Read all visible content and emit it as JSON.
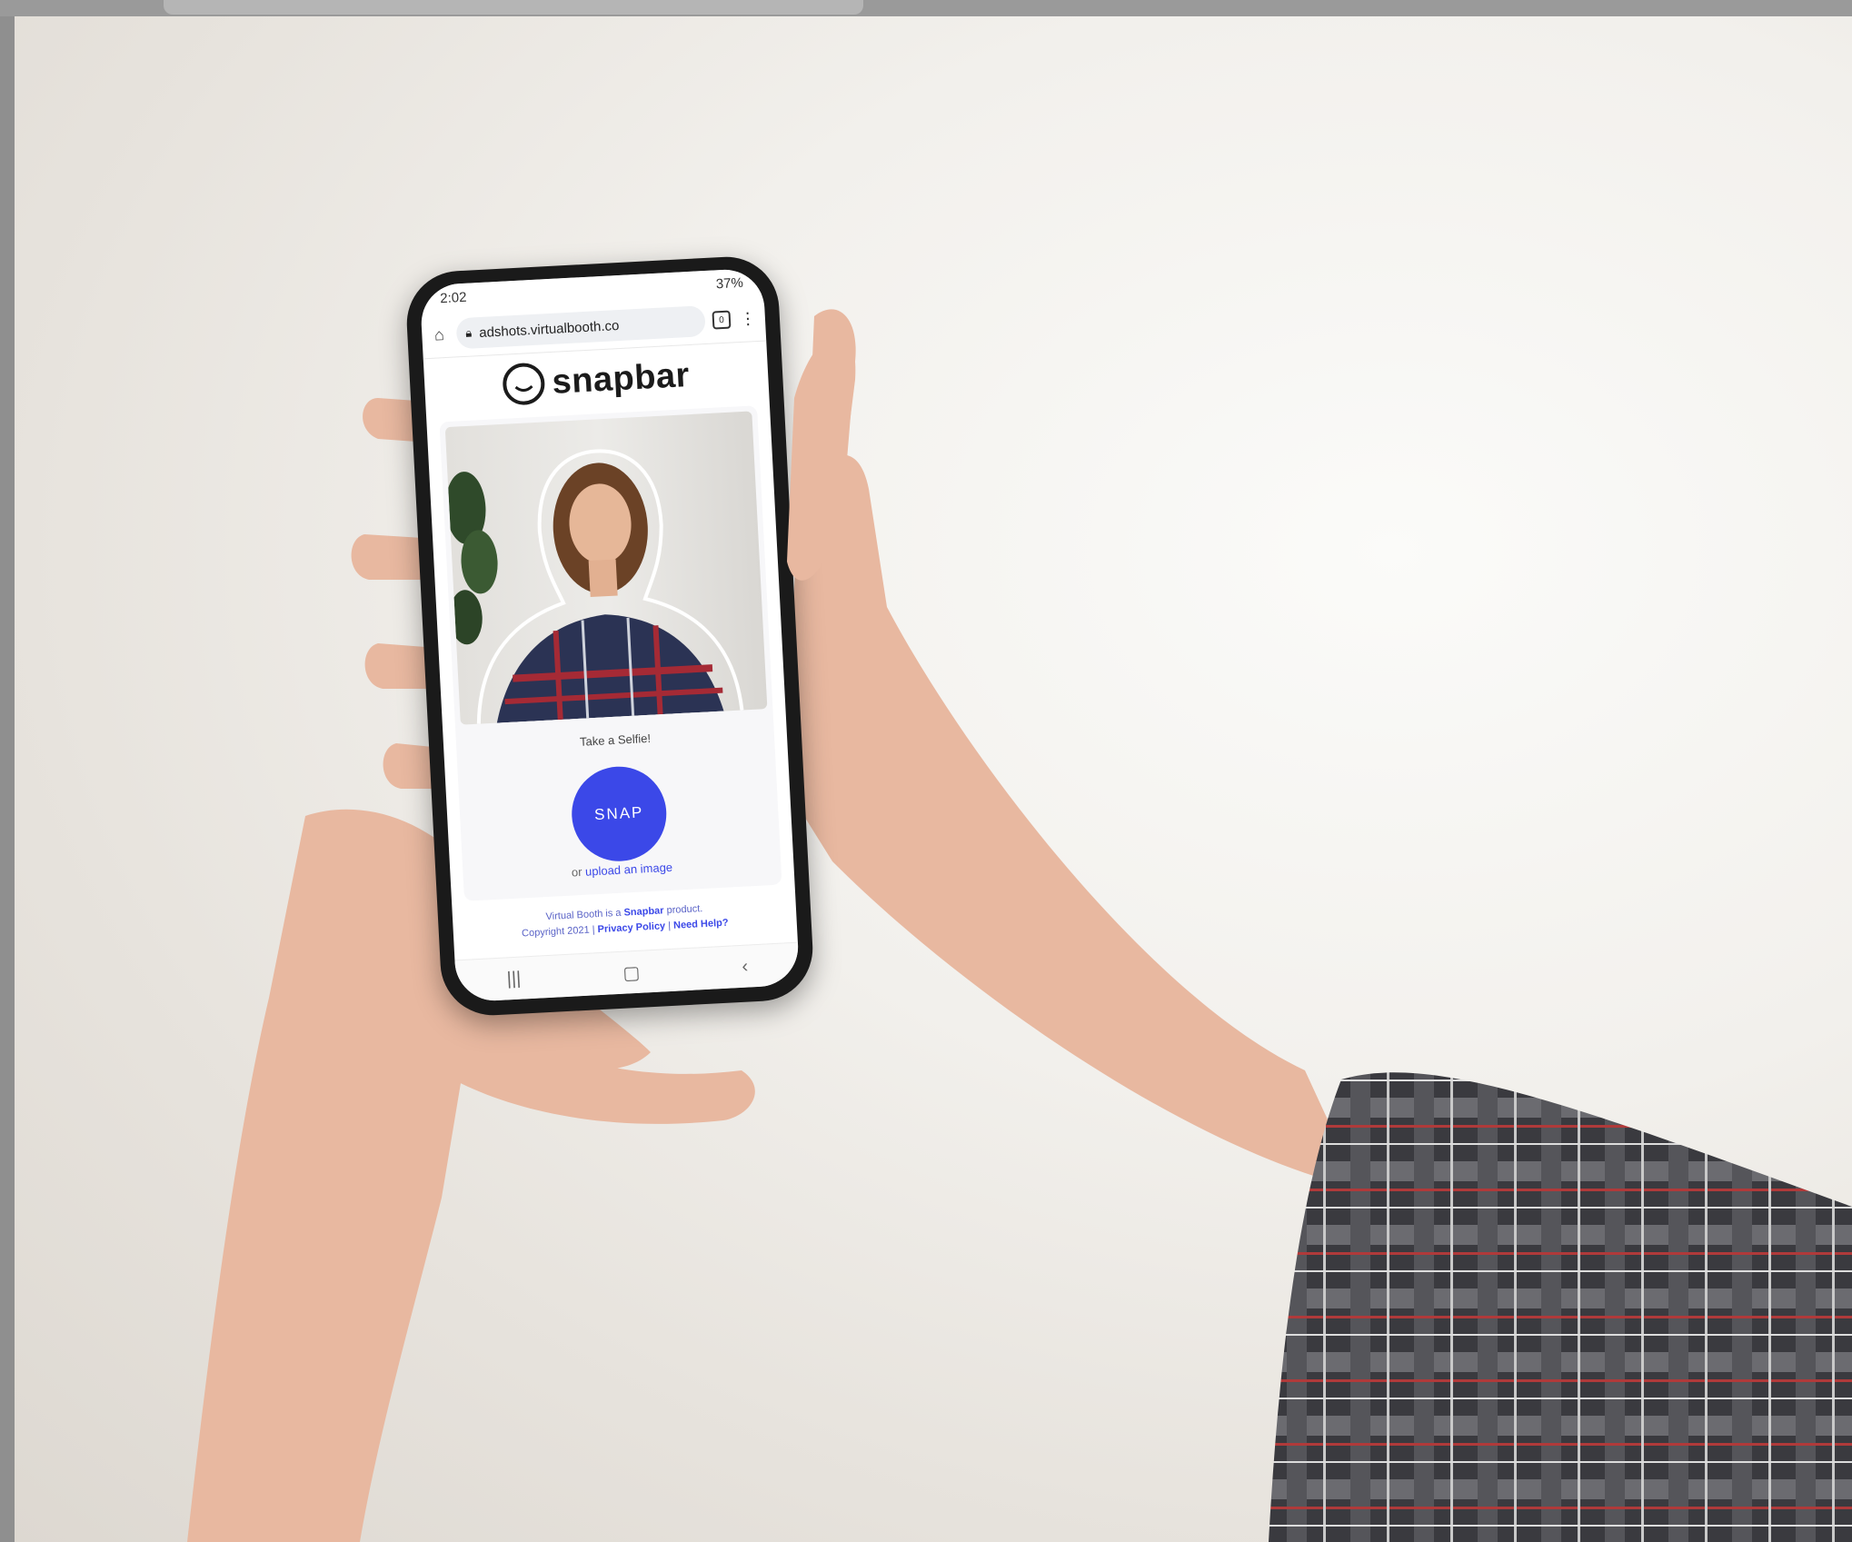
{
  "status_bar": {
    "time": "2:02",
    "battery": "37%"
  },
  "browser": {
    "url": "adshots.virtualbooth.co",
    "tabs_count": "0"
  },
  "app": {
    "brand": "snapbar",
    "prompt": "Take a Selfie!",
    "snap_label": "SNAP",
    "upload_prefix": "or",
    "upload_link": "upload an image",
    "footer_line1_prefix": "Virtual Booth is a",
    "footer_brand": "Snapbar",
    "footer_line1_suffix": "product.",
    "footer_copyright": "Copyright 2021 |",
    "privacy_link": "Privacy Policy",
    "help_link": "Need Help?"
  },
  "colors": {
    "accent": "#3b48e8",
    "phone_body": "#1a1a1a",
    "background": "#f2f0ec"
  },
  "icons": [
    "home-icon",
    "lock-icon",
    "tabs-icon",
    "more-icon",
    "recent-apps-icon",
    "home-nav-icon",
    "back-icon"
  ]
}
